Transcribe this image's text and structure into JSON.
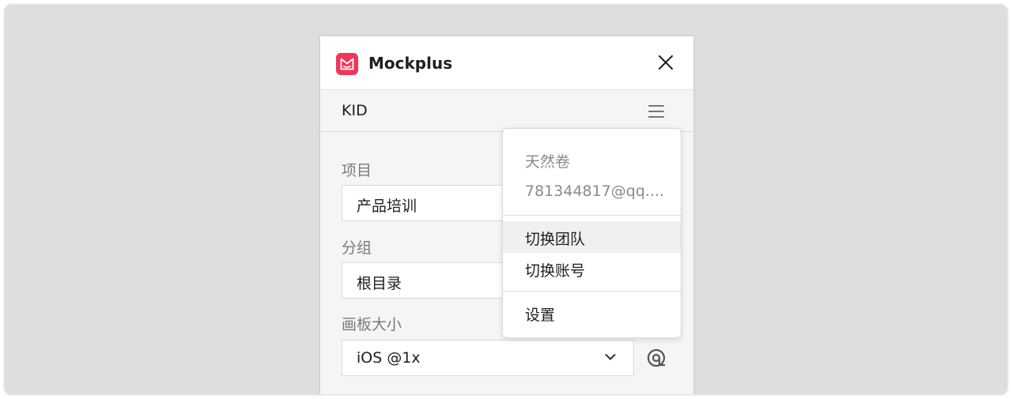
{
  "window": {
    "app_title": "Mockplus",
    "brand_color": "#f0365a"
  },
  "user": {
    "name": "KID"
  },
  "form": {
    "project_label": "项目",
    "project_value": "产品培训",
    "group_label": "分组",
    "group_value": "根目录",
    "canvas_label": "画板大小",
    "canvas_value": "iOS @1x"
  },
  "dropdown": {
    "display_name": "天然卷",
    "email": "781344817@qq....",
    "items": [
      {
        "label": "切换团队",
        "highlighted": true
      },
      {
        "label": "切换账号",
        "highlighted": false
      },
      {
        "label": "设置",
        "highlighted": false
      }
    ]
  },
  "icons": [
    "mockplus-logo-icon",
    "close-icon",
    "hamburger-menu-icon",
    "chevron-down-icon",
    "at-sign-icon"
  ]
}
